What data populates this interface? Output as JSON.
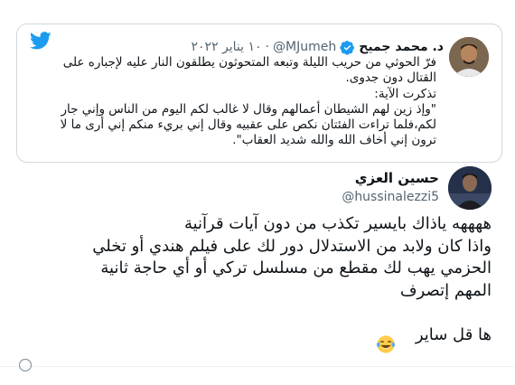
{
  "quoted_tweet": {
    "author_name": "د. محمد جميح",
    "handle": "@MJumeh",
    "separator": "·",
    "date": "١٠ يناير ٢٠٢٢",
    "text": "فرّ الحوثي من حريب الليلة وتبعه المتحوثون يطلقون النار عليه لإجباره على\nالقتال دون جدوى.\nتذكرت الآية:\n\"وإذ زين لهم الشيطان أعمالهم وقال لا غالب لكم اليوم من الناس وإني جار\nلكم،فلما تراءت الفئتان نكص على عقبيه وقال إني بريء منكم إني أرى ما لا\nترون إني أخاف الله والله شديد العقاب\"."
  },
  "reply_tweet": {
    "author_name": "حسين العزي",
    "handle": "@hussinalezzi5",
    "text": "ههههه ياذاك بايسير تكذب من دون آيات قرآنية\nواذا كان ولابد من الاستدلال دور لك على فيلم هندي أو تخلي\nالحزمي يهب لك مقطع من مسلسل تركي أو أي حاجة ثانية\nالمهم إتصرف\n\nها قل ساير"
  },
  "icons": {
    "logo": "twitter-bird-icon",
    "verified": "verified-badge-icon",
    "emoji": "laughing-tears-emoji-icon"
  },
  "colors": {
    "twitter_blue": "#1d9bf0",
    "secondary_text": "#536471",
    "border": "#cfd9de"
  }
}
